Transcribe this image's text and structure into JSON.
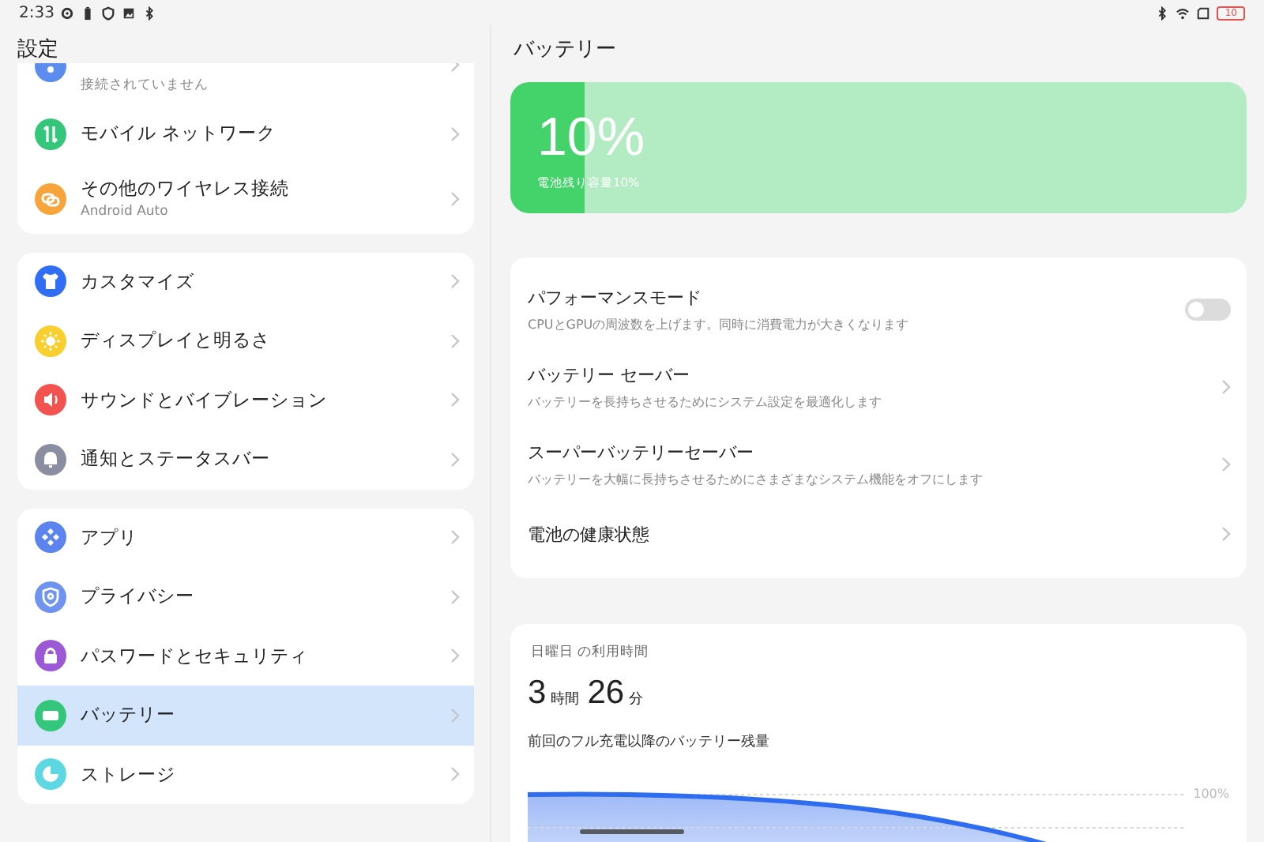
{
  "status_bar": {
    "time": "2:33",
    "battery_text": "10"
  },
  "sidebar": {
    "title": "設定",
    "groups": [
      {
        "items": [
          {
            "color": "#5b8def",
            "sublabel": "接続されていません",
            "selected": false
          },
          {
            "color": "#34c77b",
            "label": "モバイル ネットワーク",
            "selected": false
          },
          {
            "color": "#f7a53b",
            "label": "その他のワイヤレス接続",
            "sublabel": "Android Auto",
            "selected": false
          }
        ]
      },
      {
        "items": [
          {
            "color": "#2f6ef5",
            "label": "カスタマイズ",
            "selected": false
          },
          {
            "color": "#f8cf2c",
            "label": "ディスプレイと明るさ",
            "selected": false
          },
          {
            "color": "#f2534f",
            "label": "サウンドとバイブレーション",
            "selected": false
          },
          {
            "color": "#8a8ea0",
            "label": "通知とステータスバー",
            "selected": false
          }
        ]
      },
      {
        "items": [
          {
            "color": "#5b84ef",
            "label": "アプリ",
            "selected": false
          },
          {
            "color": "#6f94f0",
            "label": "プライバシー",
            "selected": false
          },
          {
            "color": "#9b59d6",
            "label": "パスワードとセキュリティ",
            "selected": false
          },
          {
            "color": "#34c77b",
            "label": "バッテリー",
            "selected": true
          },
          {
            "color": "#5dd8e2",
            "label": "ストレージ",
            "selected": false
          }
        ]
      }
    ]
  },
  "detail": {
    "title": "バッテリー",
    "battery_card": {
      "percent": "10%",
      "caption": "電池残り容量10%",
      "level": 0.1
    },
    "settings": [
      {
        "kind": "toggle",
        "title": "パフォーマンスモード",
        "subtitle": "CPUとGPUの周波数を上げます。同時に消費電力が大きくなります",
        "on": false
      },
      {
        "kind": "link",
        "title": "バッテリー セーバー",
        "subtitle": "バッテリーを長持ちさせるためにシステム設定を最適化します"
      },
      {
        "kind": "link",
        "title": "スーパーバッテリーセーバー",
        "subtitle": "バッテリーを大幅に長持ちさせるためにさまざまなシステム機能をオフにします"
      },
      {
        "kind": "link",
        "title": "電池の健康状態"
      }
    ],
    "usage": {
      "label": "日曜日 の利用時間",
      "hours": "3",
      "hours_unit": "時間",
      "minutes": "26",
      "minutes_unit": "分",
      "chart_title": "前回のフル充電以降のバッテリー残量",
      "gridline_label": "100%"
    }
  }
}
